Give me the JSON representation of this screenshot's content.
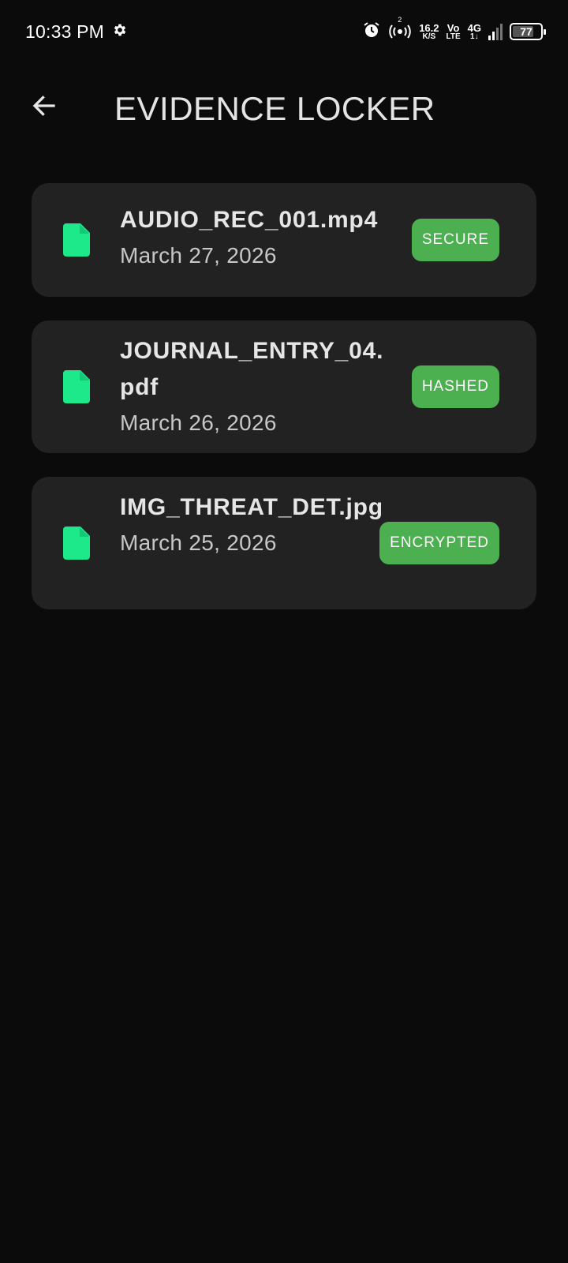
{
  "status_bar": {
    "time": "10:33 PM",
    "speed_value": "16.2",
    "speed_unit": "K/S",
    "volte_top": "Vo",
    "volte_bottom": "LTE",
    "network_top": "4G",
    "network_bottom": "1↓",
    "hotspot_count": "2",
    "battery": "77",
    "battery_level": 0.77,
    "icons": [
      "settings-gear-icon",
      "alarm-icon",
      "hotspot-icon",
      "signal-icon",
      "battery-icon"
    ]
  },
  "header": {
    "back_icon": "arrow-left-icon",
    "title": "EVIDENCE LOCKER"
  },
  "colors": {
    "background": "#0b0b0b",
    "card": "#222222",
    "file_icon": "#1de98b",
    "badge": "#4caf50"
  },
  "files": [
    {
      "name": "AUDIO_REC_001.mp4",
      "date": "March 27, 2026",
      "status": "SECURE",
      "icon": "file-icon"
    },
    {
      "name": "JOURNAL_ENTRY_04.pdf",
      "date": "March 26, 2026",
      "status": "HASHED",
      "icon": "file-icon"
    },
    {
      "name": "IMG_THREAT_DET.jpg",
      "date": "March 25, 2026",
      "status": "ENCRYPTED",
      "icon": "file-icon"
    }
  ]
}
